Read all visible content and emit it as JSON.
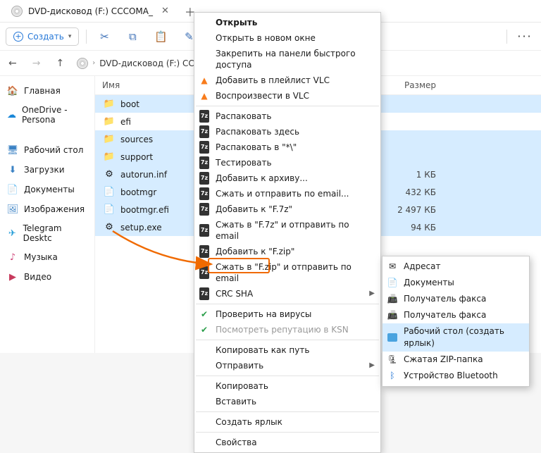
{
  "tab": {
    "title": "DVD-дисковод (F:) CCCOMA_"
  },
  "toolbar": {
    "create": "Создать"
  },
  "breadcrumb": {
    "path": "DVD-дисковод (F:) CCCOMA_"
  },
  "list_header": {
    "name": "Имя",
    "size": "Размер"
  },
  "sidebar": {
    "home": "Главная",
    "onedrive": "OneDrive - Persona",
    "desktop": "Рабочий стол",
    "downloads": "Загрузки",
    "documents": "Документы",
    "pictures": "Изображения",
    "telegram": "Telegram Desktc",
    "music": "Музыка",
    "video": "Видео"
  },
  "files": [
    {
      "name": "boot",
      "type": "folder",
      "size": ""
    },
    {
      "name": "efi",
      "type": "folder",
      "size": ""
    },
    {
      "name": "sources",
      "type": "folder",
      "size": ""
    },
    {
      "name": "support",
      "type": "folder",
      "size": ""
    },
    {
      "name": "autorun.inf",
      "type": "inf",
      "size": "1 КБ"
    },
    {
      "name": "bootmgr",
      "type": "file",
      "size": "432 КБ"
    },
    {
      "name": "bootmgr.efi",
      "type": "file",
      "size": "2 497 КБ"
    },
    {
      "name": "setup.exe",
      "type": "exe",
      "size": "94 КБ"
    }
  ],
  "ctx": {
    "open": "Открыть",
    "open_new": "Открыть в новом окне",
    "pin": "Закрепить на панели быстрого доступа",
    "vlc_playlist": "Добавить в плейлист VLC",
    "vlc_play": "Воспроизвести в VLC",
    "unpack": "Распаковать",
    "unpack_here": "Распаковать здесь",
    "unpack_to": "Распаковать в \"*\\\"",
    "test": "Тестировать",
    "add_archive": "Добавить к архиву...",
    "zip_email": "Сжать и отправить по email...",
    "add_7z": "Добавить к \"F.7z\"",
    "zip_7z_email": "Сжать в \"F.7z\" и отправить по email",
    "add_zip": "Добавить к \"F.zip\"",
    "zip_zip_email": "Сжать в \"F.zip\" и отправить по email",
    "crc": "CRC SHA",
    "virus_check": "Проверить на вирусы",
    "ksn": "Посмотреть репутацию в KSN",
    "copy_path": "Копировать как путь",
    "send_to": "Отправить",
    "copy": "Копировать",
    "paste": "Вставить",
    "shortcut": "Создать ярлык",
    "properties": "Свойства"
  },
  "submenu": {
    "recipient": "Адресат",
    "documents": "Документы",
    "fax1": "Получатель факса",
    "fax2": "Получатель факса",
    "desktop": "Рабочий стол (создать ярлык)",
    "zip": "Сжатая ZIP-папка",
    "bluetooth": "Устройство Bluetooth"
  }
}
